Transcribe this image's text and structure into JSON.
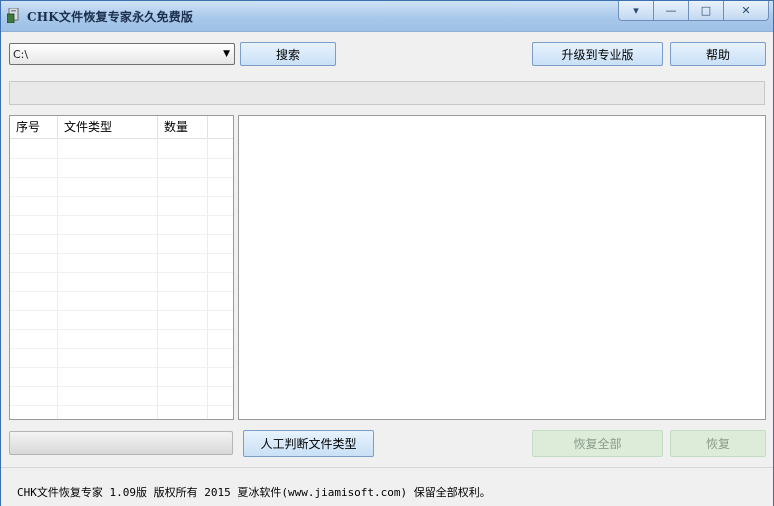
{
  "window": {
    "title": "CHK文件恢复专家永久免费版",
    "controls": {
      "menu": "▾",
      "minimize": "—",
      "maximize": "□",
      "close": "✕"
    }
  },
  "toolbar": {
    "drive_value": "C:\\",
    "search_label": "搜索",
    "upgrade_label": "升级到专业版",
    "help_label": "帮助"
  },
  "file_list": {
    "columns": [
      "序号",
      "文件类型",
      "数量"
    ],
    "rows": []
  },
  "bottom": {
    "identify_label": "人工判断文件类型",
    "recover_all_label": "恢复全部",
    "recover_label": "恢复"
  },
  "status": {
    "text": "CHK文件恢复专家 1.09版  版权所有 2015 夏冰软件(www.jiamisoft.com) 保留全部权利。"
  },
  "colors": {
    "title_bar": "#a9c8ea",
    "button_accent": "#c9e0f6",
    "disabled_button": "#dcecd8"
  }
}
